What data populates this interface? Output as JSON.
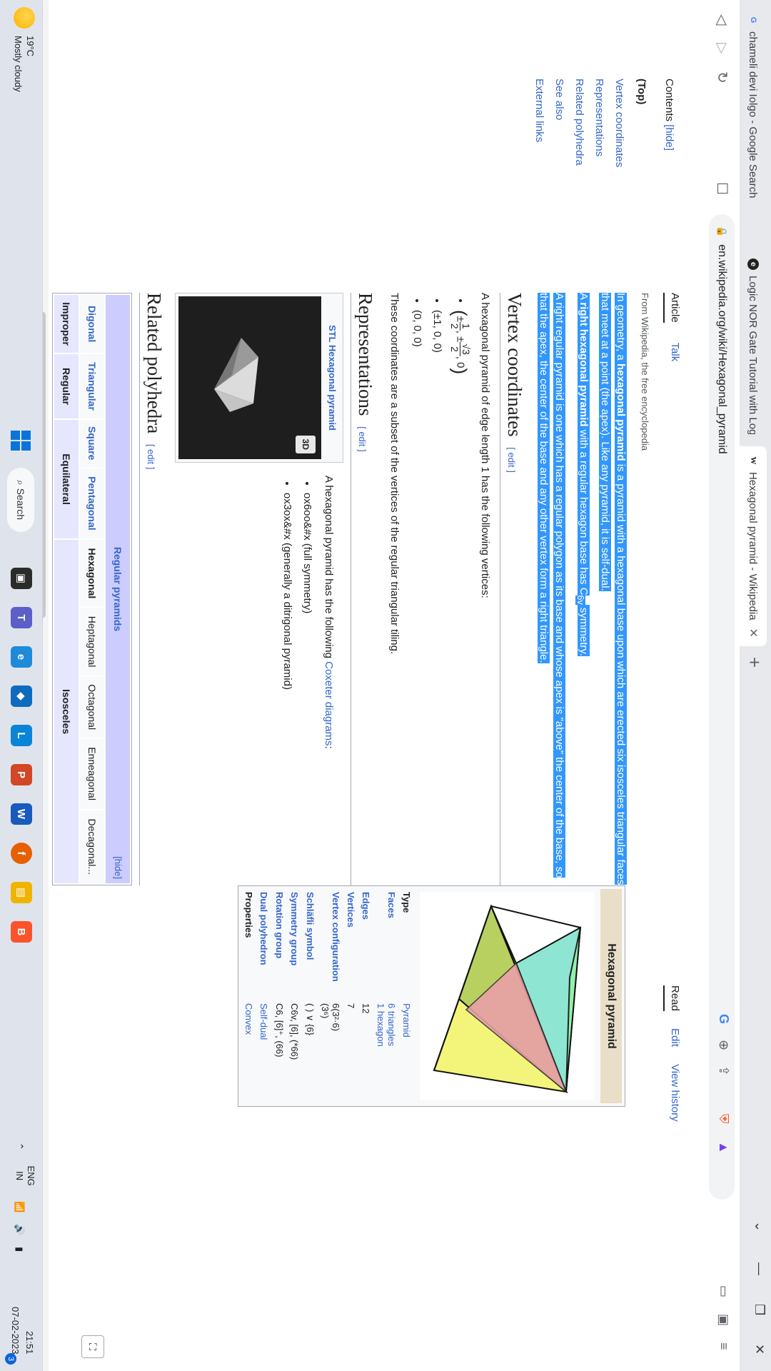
{
  "browser": {
    "tabs": [
      {
        "title": "chameli devi Iolgo - Google Search",
        "icon": "google-icon"
      },
      {
        "title": "Logic NOR Gate Tutorial with Logic N",
        "icon": "electronics-tutorials-icon"
      },
      {
        "title": "Hexagonal pyramid - Wikipedia",
        "icon": "wikipedia-icon"
      }
    ],
    "url": "en.wikipedia.org/wiki/Hexagonal_pyramid"
  },
  "toc": {
    "label": "Contents",
    "hide": "[hide]",
    "items": [
      "(Top)",
      "Vertex coordinates",
      "Representations",
      "Related polyhedra",
      "See also",
      "External links"
    ]
  },
  "page_tabs": {
    "article": "Article",
    "talk": "Talk",
    "read": "Read",
    "edit": "Edit",
    "history": "View history"
  },
  "article": {
    "from": "From Wikipedia, the free encyclopedia",
    "intro_pre": "In geometry, a ",
    "intro_bold": "hexagonal pyramid",
    "intro_post": " is a pyramid with a hexagonal base upon which are erected six isosceles triangular faces that meet at a point (the apex). Like any pyramid, it is self-dual.",
    "right_pre": "A ",
    "right_bold": "right hexagonal pyramid",
    "right_post": " with a regular hexagon base has C",
    "right_sub": "6v",
    "right_end": " symmetry.",
    "regular_text": "A right regular pyramid is one which has a regular polygon as its base and whose apex is \"above\" the center of the base, so that the apex, the center of the base and any other vertex form a right triangle.",
    "h_vertex": "Vertex coordinates",
    "edit": "[ edit ]",
    "vertex_intro": "A hexagonal pyramid of edge length 1 has the following vertices:",
    "coord2": "(±1, 0, 0)",
    "coord3": "(0, 0, 0)",
    "vertex_outro": "These coordinates are a subset of the vertices of the regular triangular tiling.",
    "h_repr": "Representations",
    "stl_caption": "STL Hexagonal pyramid",
    "stl_button": "3D",
    "coxeter_pre": "A hexagonal pyramid has the following ",
    "coxeter_link": "Coxeter diagrams",
    "coxeter_post": ":",
    "cox1": "ox6oo&#x (full symmetry)",
    "cox2": "ox3ox&#x (generally a ditrigonal pyramid)",
    "h_related": "Related polyhedra"
  },
  "navbox": {
    "title": "Regular pyramids",
    "hide": "[hide]",
    "row_names": [
      "Digonal",
      "Triangular",
      "Square",
      "Pentagonal",
      "Hexagonal",
      "Heptagonal",
      "Octagonal",
      "Enneagonal",
      "Decagonal..."
    ],
    "row2": [
      "Improper",
      "Regular",
      "Equilateral",
      "Isosceles"
    ]
  },
  "infobox": {
    "title": "Hexagonal pyramid",
    "rows": [
      {
        "label": "Type",
        "value": "Pyramid"
      },
      {
        "label": "Faces",
        "value": "6 triangles\n1 hexagon"
      },
      {
        "label": "Edges",
        "value": "12"
      },
      {
        "label": "Vertices",
        "value": "7"
      },
      {
        "label": "Vertex configuration",
        "value": "6(3²·6)\n(3⁶)"
      },
      {
        "label": "Schläfli symbol",
        "value": "( ) ∨ {6}"
      },
      {
        "label": "Symmetry group",
        "value": "C6v, [6], (*66)"
      },
      {
        "label": "Rotation group",
        "value": "C6, [6]⁺, (66)"
      },
      {
        "label": "Dual polyhedron",
        "value": "Self-dual"
      },
      {
        "label": "Properties",
        "value": "Convex"
      }
    ]
  },
  "taskbar": {
    "temp": "19°C",
    "weather": "Mostly cloudy",
    "search": "Search",
    "lang1": "ENG",
    "lang2": "IN",
    "time": "21:51",
    "date": "07-02-2023",
    "badge": "3"
  },
  "colors": {
    "link": "#3366cc",
    "selection": "#3297fd",
    "infobox_header": "#e9dfc8",
    "navbox_header": "#ccccff"
  }
}
